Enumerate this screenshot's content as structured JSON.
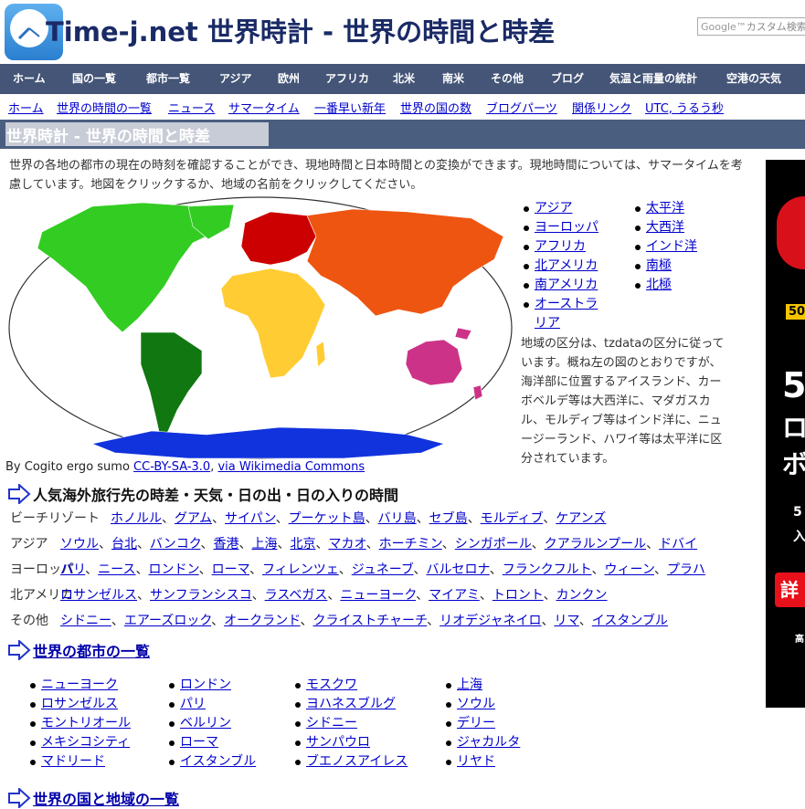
{
  "header": {
    "title": "Time-j.net 世界時計 - 世界の時間と時差",
    "search_placeholder": "カスタム検索",
    "search_brand": "Google™"
  },
  "nav": [
    "ホーム",
    "国の一覧",
    "都市一覧",
    "アジア",
    "欧州",
    "アフリカ",
    "北米",
    "南米",
    "その他",
    "ブログ",
    "気温と雨量の統計",
    "空港の天気"
  ],
  "subnav": [
    "ホーム",
    "世界の時間の一覧",
    "ニュース",
    "サマータイム",
    "一番早い新年",
    "世界の国の数",
    "ブログパーツ",
    "関係リンク",
    "UTC, うるう秒"
  ],
  "page_title": "世界時計 - 世界の時間と時差",
  "intro": "世界の各地の都市の現在の時刻を確認することができ、現地時間と日本時間との変換ができます。現地時間については、サマータイムを考慮しています。地図をクリックするか、地域の名前をクリックしてください。",
  "regions_col1": [
    "アジア",
    "ヨーロッパ",
    "アフリカ",
    "北アメリカ",
    "南アメリカ",
    "オーストラリア"
  ],
  "regions_col2": [
    "太平洋",
    "大西洋",
    "インド洋",
    "南極",
    "北極"
  ],
  "region_note": "地域の区分は、tzdataの区分に従っています。概ね左の図のとおりですが、海洋部に位置するアイスランド、カーボベルデ等は大西洋に、マダガスカル、モルディブ等はインド洋に、ニュージーランド、ハワイ等は太平洋に区分されています。",
  "credit": {
    "text": "By Cogito ergo sumo ",
    "license": "CC-BY-SA-3.0",
    "sep": ", ",
    "via": "via Wikimedia Commons"
  },
  "travel": {
    "heading": "人気海外旅行先の時差・天気・日の出・日の入りの時間",
    "rows": [
      {
        "category": "ビーチリゾート",
        "cities": [
          "ホノルル",
          "グアム",
          "サイパン",
          "プーケット島",
          "バリ島",
          "セブ島",
          "モルディブ",
          "ケアンズ"
        ]
      },
      {
        "category": "アジア",
        "cities": [
          "ソウル",
          "台北",
          "バンコク",
          "香港",
          "上海",
          "北京",
          "マカオ",
          "ホーチミン",
          "シンガポール",
          "クアラルンプール",
          "ドバイ"
        ]
      },
      {
        "category": "ヨーロッパ",
        "cities": [
          "パリ",
          "ニース",
          "ロンドン",
          "ローマ",
          "フィレンツェ",
          "ジュネーブ",
          "バルセロナ",
          "フランクフルト",
          "ウィーン",
          "プラハ"
        ]
      },
      {
        "category": "北アメリカ",
        "cities": [
          "ロサンゼルス",
          "サンフランシスコ",
          "ラスベガス",
          "ニューヨーク",
          "マイアミ",
          "トロント",
          "カンクン"
        ]
      },
      {
        "category": "その他",
        "cities": [
          "シドニー",
          "エアーズロック",
          "オークランド",
          "クライストチャーチ",
          "リオデジャネイロ",
          "リマ",
          "イスタンブル"
        ]
      }
    ]
  },
  "cities": {
    "heading": "世界の都市の一覧",
    "columns": [
      [
        "ニューヨーク",
        "ロサンゼルス",
        "モントリオール",
        "メキシコシティ",
        "マドリード"
      ],
      [
        "ロンドン",
        "パリ",
        "ベルリン",
        "ローマ",
        "イスタンブル"
      ],
      [
        "モスクワ",
        "ヨハネスブルグ",
        "シドニー",
        "サンパウロ",
        "ブエノスアイレス"
      ],
      [
        "上海",
        "ソウル",
        "デリー",
        "ジャカルタ",
        "リヤド"
      ]
    ]
  },
  "countries_heading": "世界の国と地域の一覧",
  "ad": {
    "t1": "50",
    "t2": "5",
    "t3": "ロ",
    "t4": "ボ",
    "t5": "5",
    "t6": "入",
    "btn": "詳",
    "t7": "高"
  },
  "colors": {
    "nav_bg": "#445577",
    "title_bg": "#4a5e80",
    "link": "#0000cc",
    "asia": "#ee5511",
    "europe": "#cc0000",
    "africa": "#ffcc33",
    "north_america": "#33cc22",
    "south_america": "#117711",
    "australia": "#cc3388",
    "antarctica": "#1133dd"
  }
}
